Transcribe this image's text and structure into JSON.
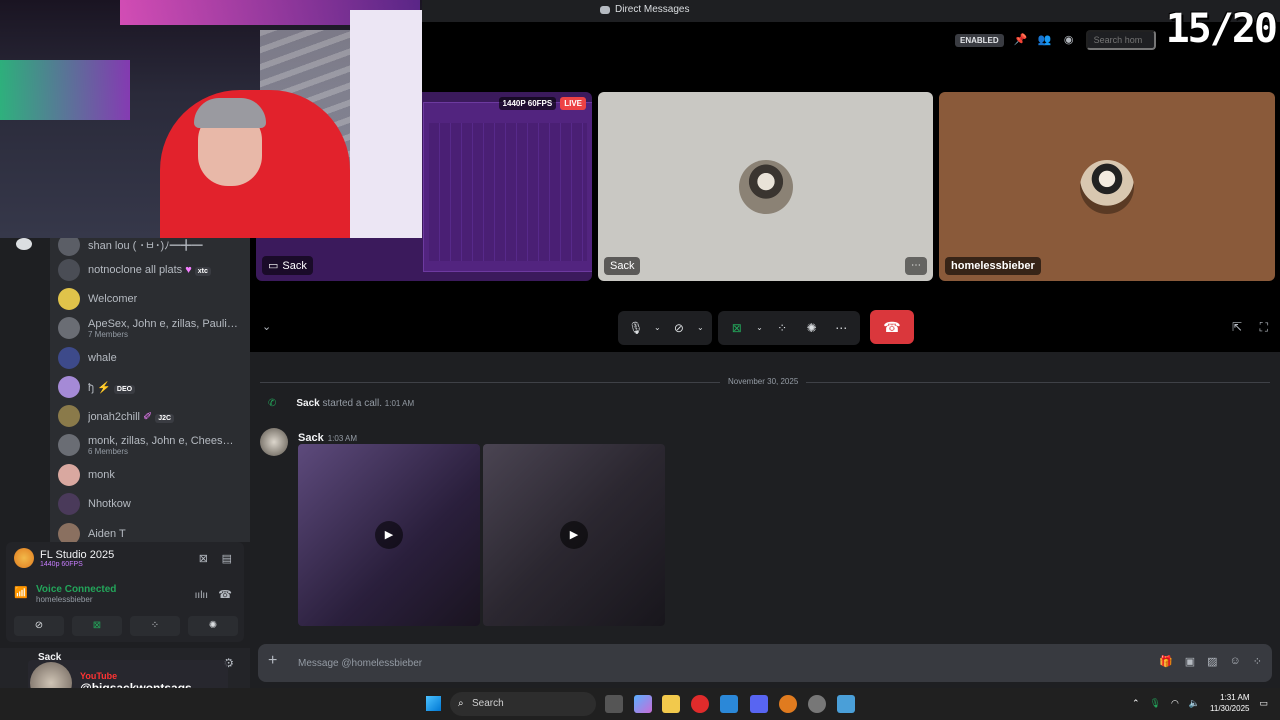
{
  "window": {
    "title": "Direct Messages"
  },
  "counter": "15/20",
  "topbar": {
    "enabled_badge": "ENABLED",
    "search_placeholder": "Search hom"
  },
  "tiles": {
    "stream": {
      "quality": "1440P 60FPS",
      "live": "LIVE",
      "name": "Sack"
    },
    "sack": {
      "name": "Sack"
    },
    "homeless": {
      "name": "homelessbieber"
    }
  },
  "dms": [
    {
      "name": "shan lou ( ･ㅂ･)ﾉ━╋━",
      "sub": ""
    },
    {
      "name": "notnoclone all plats",
      "tag": "xtc",
      "sub": ""
    },
    {
      "name": "Welcomer",
      "sub": ""
    },
    {
      "name": "ApeSex, John e, zillas, Paulie...",
      "sub": "7 Members"
    },
    {
      "name": "whale",
      "sub": ""
    },
    {
      "name": "ђ",
      "tag": "DEO",
      "sub": ""
    },
    {
      "name": "jonah2chill",
      "tag": "J2C",
      "sub": ""
    },
    {
      "name": "monk, zillas, John e, CheeseW...",
      "sub": "6 Members"
    },
    {
      "name": "monk",
      "sub": ""
    },
    {
      "name": "Nhotkow",
      "sub": ""
    },
    {
      "name": "Aiden T",
      "sub": ""
    }
  ],
  "stream_panel": {
    "title": "FL Studio 2025",
    "sub": "1440p 60FPS"
  },
  "voice": {
    "title": "Voice Connected",
    "sub": "homelessbieber"
  },
  "user": {
    "name": "Sack"
  },
  "overlay": {
    "label": "YouTube",
    "handle": "@bigsackwontsags"
  },
  "chat": {
    "date": "November 30, 2025",
    "system": {
      "name": "Sack",
      "text": "started a call.",
      "time": "1:01 AM"
    },
    "message": {
      "name": "Sack",
      "time": "1:03 AM"
    },
    "composer_placeholder": "Message @homelessbieber"
  },
  "taskbar": {
    "search": "Search",
    "time": "1:31 AM",
    "date": "11/30/2025"
  }
}
